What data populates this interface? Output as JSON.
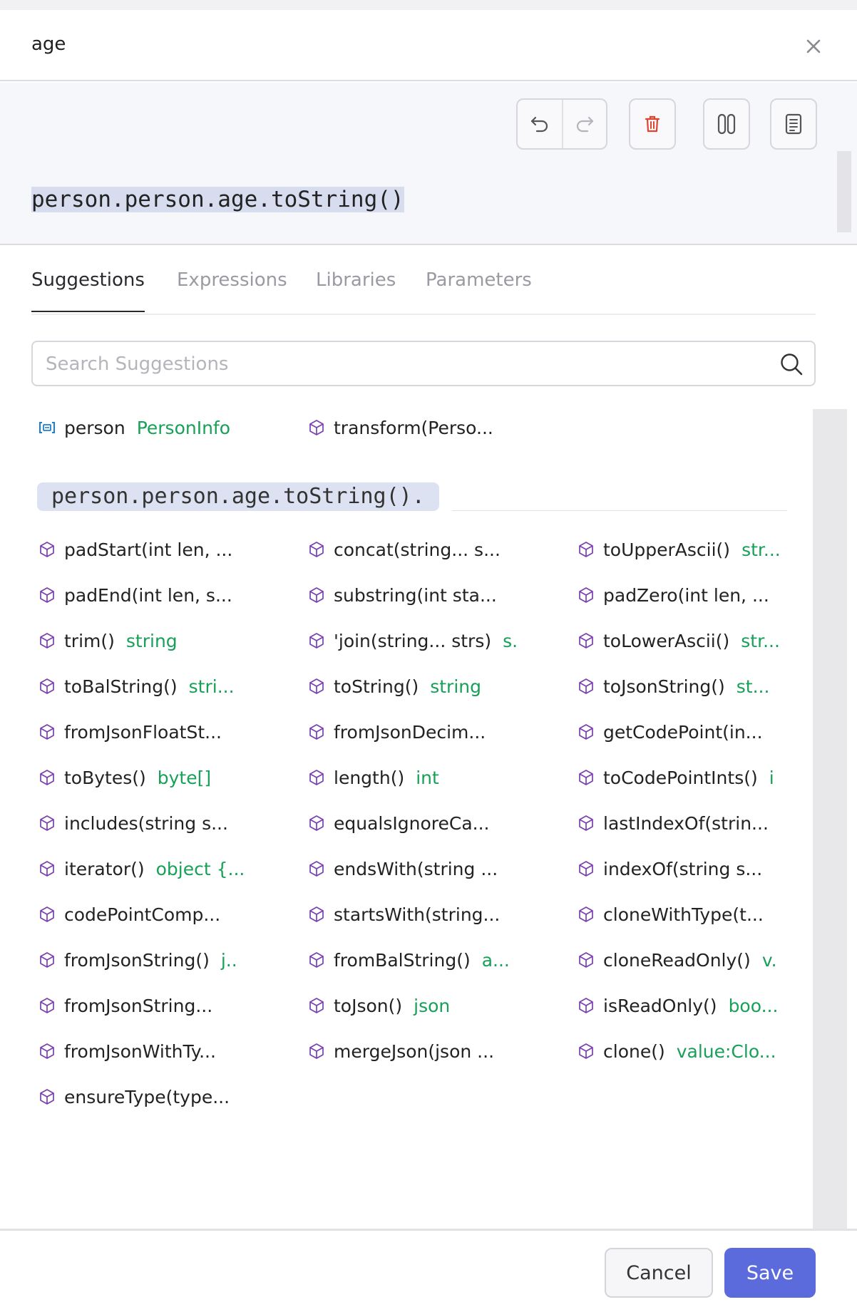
{
  "dialog": {
    "title": "age"
  },
  "editor": {
    "expression": "person.person.age.toString()"
  },
  "tabs": [
    {
      "label": "Suggestions",
      "active": true
    },
    {
      "label": "Expressions",
      "active": false
    },
    {
      "label": "Libraries",
      "active": false
    },
    {
      "label": "Parameters",
      "active": false
    }
  ],
  "search": {
    "placeholder": "Search Suggestions",
    "value": ""
  },
  "variables": [
    {
      "name": "person",
      "type": "PersonInfo",
      "icon": "variable-icon"
    },
    {
      "name": "transform(Perso...",
      "type": "",
      "icon": "method-icon"
    }
  ],
  "section": {
    "label": "person.person.age.toString()."
  },
  "methods": [
    [
      {
        "name": "padStart(int len, ...",
        "type": ""
      },
      {
        "name": "padEnd(int len, s...",
        "type": ""
      },
      {
        "name": "trim()",
        "type": "string"
      },
      {
        "name": "toBalString()",
        "type": "stri..."
      },
      {
        "name": "fromJsonFloatSt...",
        "type": ""
      },
      {
        "name": "toBytes()",
        "type": "byte[]"
      },
      {
        "name": "includes(string s...",
        "type": ""
      },
      {
        "name": "iterator()",
        "type": "object {..."
      },
      {
        "name": "codePointComp...",
        "type": ""
      },
      {
        "name": "fromJsonString()",
        "type": "j.."
      },
      {
        "name": "fromJsonString...",
        "type": ""
      },
      {
        "name": "fromJsonWithTy...",
        "type": ""
      },
      {
        "name": "ensureType(type...",
        "type": ""
      }
    ],
    [
      {
        "name": "concat(string... s...",
        "type": ""
      },
      {
        "name": "substring(int sta...",
        "type": ""
      },
      {
        "name": "'join(string... strs)",
        "type": "s."
      },
      {
        "name": "toString()",
        "type": "string"
      },
      {
        "name": "fromJsonDecim...",
        "type": ""
      },
      {
        "name": "length()",
        "type": "int"
      },
      {
        "name": "equalsIgnoreCa...",
        "type": ""
      },
      {
        "name": "endsWith(string ...",
        "type": ""
      },
      {
        "name": "startsWith(string...",
        "type": ""
      },
      {
        "name": "fromBalString()",
        "type": "a..."
      },
      {
        "name": "toJson()",
        "type": "json"
      },
      {
        "name": "mergeJson(json ...",
        "type": ""
      }
    ],
    [
      {
        "name": "toUpperAscii()",
        "type": "str..."
      },
      {
        "name": "padZero(int len, ...",
        "type": ""
      },
      {
        "name": "toLowerAscii()",
        "type": "str..."
      },
      {
        "name": "toJsonString()",
        "type": "st..."
      },
      {
        "name": "getCodePoint(in...",
        "type": ""
      },
      {
        "name": "toCodePointInts()",
        "type": "i"
      },
      {
        "name": "lastIndexOf(strin...",
        "type": ""
      },
      {
        "name": "indexOf(string s...",
        "type": ""
      },
      {
        "name": "cloneWithType(t...",
        "type": ""
      },
      {
        "name": "cloneReadOnly()",
        "type": "v."
      },
      {
        "name": "isReadOnly()",
        "type": "boo..."
      },
      {
        "name": "clone()",
        "type": "value:Clo..."
      }
    ]
  ],
  "footer": {
    "cancel_label": "Cancel",
    "save_label": "Save"
  },
  "colors": {
    "accent": "#5b6bdc",
    "type": "#18a058",
    "method_icon": "#7a3fb0",
    "delete_icon": "#e0442f",
    "variable_icon": "#1f7fd1"
  }
}
